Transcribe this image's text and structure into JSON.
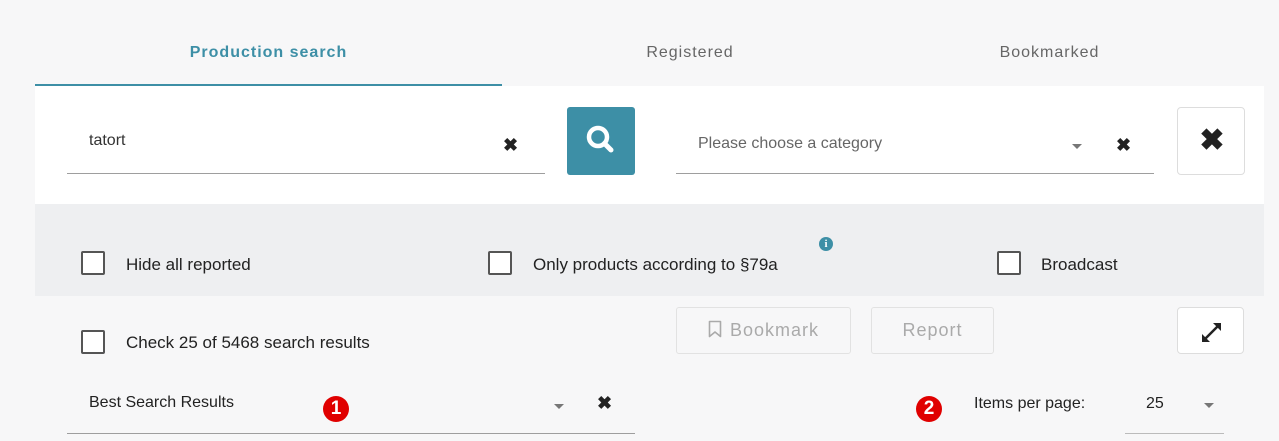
{
  "tabs": [
    {
      "label": "Production search",
      "active": true
    },
    {
      "label": "Registered",
      "active": false
    },
    {
      "label": "Bookmarked",
      "active": false
    }
  ],
  "search": {
    "query_value": "tatort",
    "clear_glyph": "✖",
    "search_icon": "search-icon"
  },
  "category": {
    "placeholder": "Please choose a category",
    "clear_glyph": "✖"
  },
  "reset": {
    "glyph": "✖"
  },
  "filters": {
    "hide_reported": "Hide all reported",
    "only_79a": "Only products according to §79a",
    "info_glyph": "i",
    "broadcast": "Broadcast"
  },
  "results": {
    "check_label": "Check 25 of 5468 search results"
  },
  "actions": {
    "bookmark": "Bookmark",
    "report": "Report",
    "expand_icon": "expand-icon"
  },
  "sort": {
    "value": "Best Search Results",
    "clear_glyph": "✖",
    "badge": "1"
  },
  "pagination": {
    "badge": "2",
    "label": "Items per page:",
    "value": "25"
  },
  "colors": {
    "accent": "#3d8fa6",
    "badge_red": "#e00000",
    "panel_bg": "#ffffff",
    "filter_bg": "#eeeff1"
  }
}
